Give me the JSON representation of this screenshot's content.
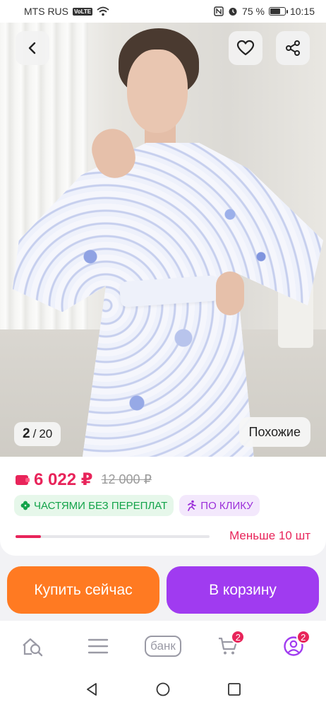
{
  "status_bar": {
    "carrier": "MTS RUS",
    "volte": "VoLTE",
    "battery": "75 %",
    "battery_level": 0.75,
    "time": "10:15"
  },
  "gallery": {
    "current": "2",
    "separator": "/",
    "total": "20",
    "similar_label": "Похожие"
  },
  "product": {
    "price": "6 022 ₽",
    "old_price": "12 000 ₽",
    "chip_installments": "ЧАСТЯМИ БЕЗ ПЕРЕПЛАТ",
    "chip_one_click": "ПО КЛИКУ",
    "stock_text": "Меньше 10 шт",
    "stock_level": 0.13
  },
  "actions": {
    "buy_now": "Купить сейчас",
    "add_to_cart": "В корзину"
  },
  "bottom_nav": {
    "bank_label": "банк",
    "cart_badge": "2",
    "profile_badge": "2"
  },
  "colors": {
    "accent_red": "#e8245a",
    "buy_orange": "#ff7a22",
    "cart_purple": "#a03bf0",
    "green": "#13a34a"
  }
}
